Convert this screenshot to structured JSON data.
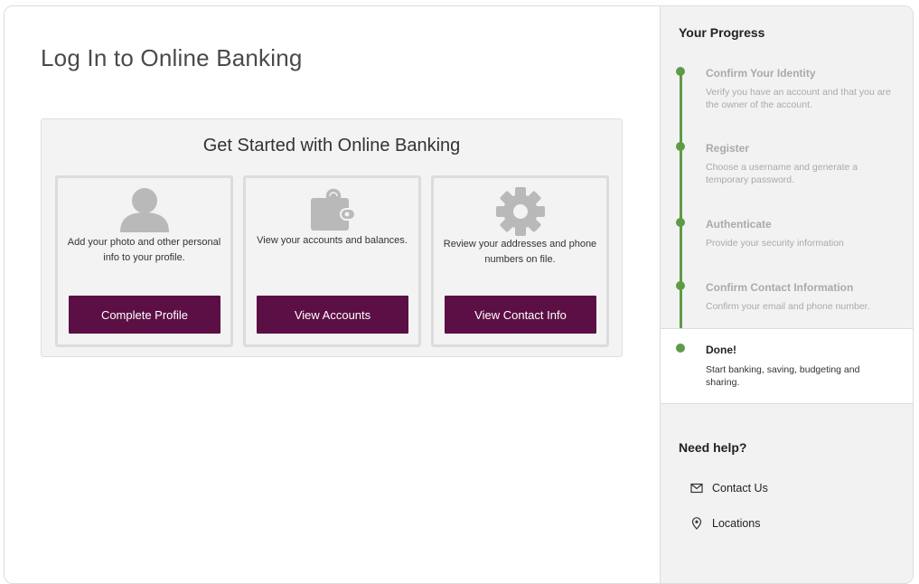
{
  "page": {
    "title": "Log In to Online Banking"
  },
  "card": {
    "title": "Get Started with Online Banking",
    "tiles": [
      {
        "icon": "user-icon",
        "text": "Add your photo and other personal info to your profile.",
        "button": "Complete Profile"
      },
      {
        "icon": "wallet-icon",
        "text": "View your accounts and balances.",
        "button": "View Accounts"
      },
      {
        "icon": "gear-icon",
        "text": "Review your addresses and phone numbers on file.",
        "button": "View Contact Info"
      }
    ]
  },
  "progress": {
    "heading": "Your Progress",
    "steps": [
      {
        "title": "Confirm Your Identity",
        "desc": "Verify you have an account and that you are the owner of the account.",
        "state": "done"
      },
      {
        "title": "Register",
        "desc": "Choose a username and generate a temporary password.",
        "state": "done"
      },
      {
        "title": "Authenticate",
        "desc": "Provide your security information",
        "state": "done"
      },
      {
        "title": "Confirm Contact Information",
        "desc": "Confirm your email and phone number.",
        "state": "done"
      },
      {
        "title": "Done!",
        "desc": "Start banking, saving, budgeting and sharing.",
        "state": "current"
      }
    ]
  },
  "help": {
    "heading": "Need help?",
    "links": [
      {
        "icon": "mail-icon",
        "label": "Contact Us"
      },
      {
        "icon": "location-pin-icon",
        "label": "Locations"
      }
    ]
  },
  "colors": {
    "accent": "#5c0f44",
    "progress": "#5e9b47"
  }
}
